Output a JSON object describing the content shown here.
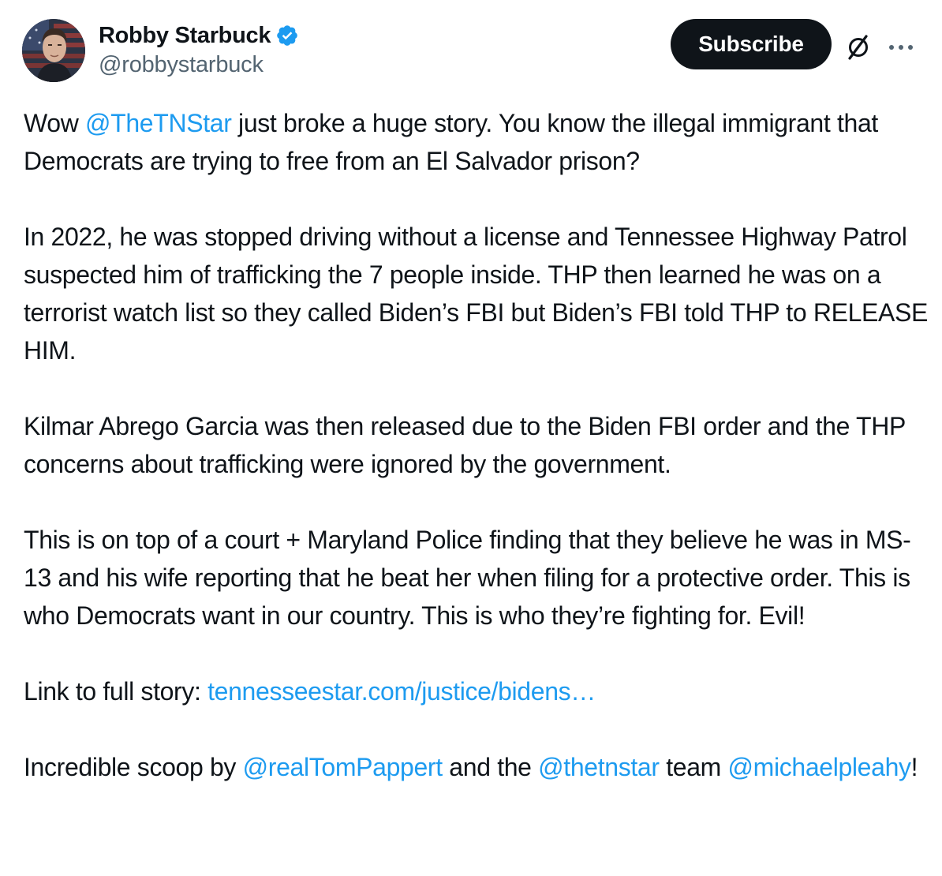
{
  "author": {
    "display_name": "Robby Starbuck",
    "handle": "@robbystarbuck",
    "verified": true
  },
  "actions": {
    "subscribe_label": "Subscribe",
    "grok_icon": "grok-slash-icon",
    "more_icon": "more-horizontal-icon"
  },
  "colors": {
    "link": "#1d9bf0",
    "text": "#0f1419",
    "secondary": "#536471",
    "button_bg": "#0f1419"
  },
  "tweet": {
    "p1": {
      "a": "Wow ",
      "mention": "@TheTNStar",
      "b": " just broke a huge story. You know the illegal immigrant that Democrats are trying to free from an El Salvador prison?"
    },
    "p2": "In 2022, he was stopped driving without a license and Tennessee Highway Patrol suspected him of trafficking the 7 people inside. THP then learned he was on a terrorist watch list so they called Biden’s FBI but Biden’s FBI told THP to RELEASE HIM.",
    "p3": "Kilmar Abrego Garcia was then released due to the Biden FBI order and the THP concerns about trafficking were ignored by the government.",
    "p4": "This is on top of a court + Maryland Police finding that they believe he was in MS-13 and his wife reporting that he beat her when filing for a protective order. This is who Democrats want in our country. This is who they’re fighting for. Evil!",
    "p5": {
      "a": "Link to full story: ",
      "link": "tennesseestar.com/justice/bidens…"
    },
    "p6": {
      "a": "Incredible scoop by ",
      "mention1": "@realTomPappert",
      "b": " and the ",
      "mention2": "@thetnstar",
      "c": " team ",
      "mention3": "@michaelpleahy",
      "d": "!"
    }
  }
}
